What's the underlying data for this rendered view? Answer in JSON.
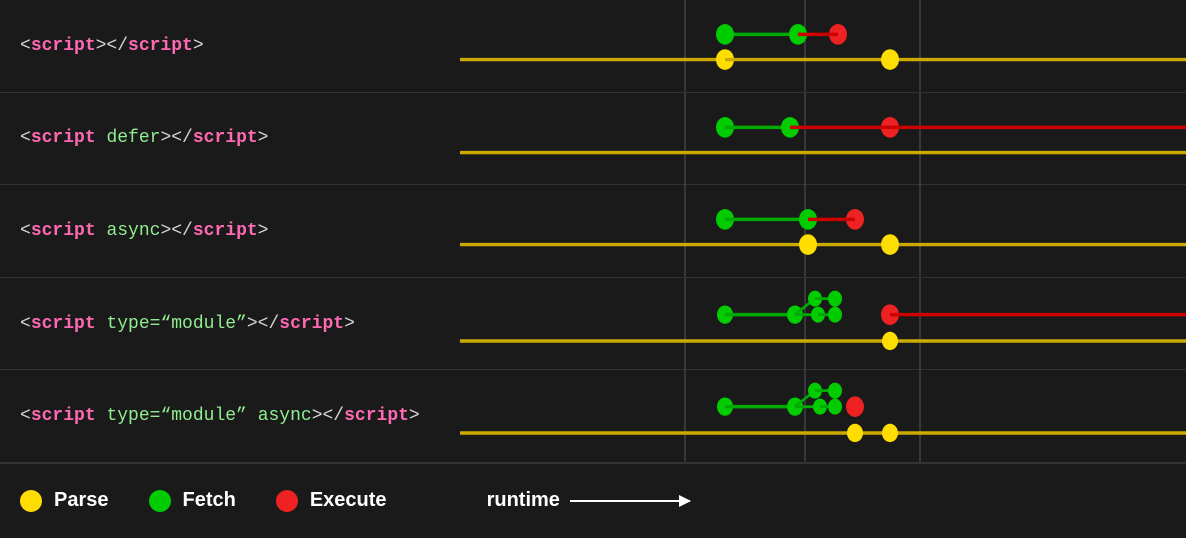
{
  "rows": [
    {
      "id": "script-basic",
      "label_parts": [
        {
          "text": "<",
          "class": "tag-open"
        },
        {
          "text": "script",
          "class": "tag-name"
        },
        {
          "text": "></",
          "class": "tag-open"
        },
        {
          "text": "script",
          "class": "tag-name"
        },
        {
          "text": ">",
          "class": "tag-open"
        }
      ],
      "label_html": "&lt;<span class='tag-name'>script</span>&gt;&lt;/<span class='tag-name'>script</span>&gt;"
    },
    {
      "id": "script-defer",
      "label_html": "&lt;<span class='tag-name'>script</span> <span class='tag-attr'>defer</span>&gt;&lt;/<span class='tag-name'>script</span>&gt;"
    },
    {
      "id": "script-async",
      "label_html": "&lt;<span class='tag-name'>script</span> <span class='tag-attr'>async</span>&gt;&lt;/<span class='tag-name'>script</span>&gt;"
    },
    {
      "id": "script-module",
      "label_html": "&lt;<span class='tag-name'>script</span> <span class='tag-attr'>type=&ldquo;module&rdquo;</span>&gt;&lt;/<span class='tag-name'>script</span>&gt;"
    },
    {
      "id": "script-module-async",
      "label_html": "&lt;<span class='tag-name'>script</span> <span class='tag-attr'>type=&ldquo;module&rdquo;</span> <span class='tag-attr'>async</span>&gt;&lt;/<span class='tag-name'>script</span>&gt;"
    }
  ],
  "legend": {
    "items": [
      {
        "color": "#ffdd00",
        "label": "Parse"
      },
      {
        "color": "#00cc00",
        "label": "Fetch"
      },
      {
        "color": "#ee2222",
        "label": "Execute"
      }
    ],
    "runtime_label": "runtime"
  },
  "colors": {
    "yellow": "#ffdd00",
    "green": "#00cc00",
    "red": "#ee2222",
    "line_yellow": "#ccaa00",
    "background": "#1a1a1a",
    "grid": "#555555"
  }
}
